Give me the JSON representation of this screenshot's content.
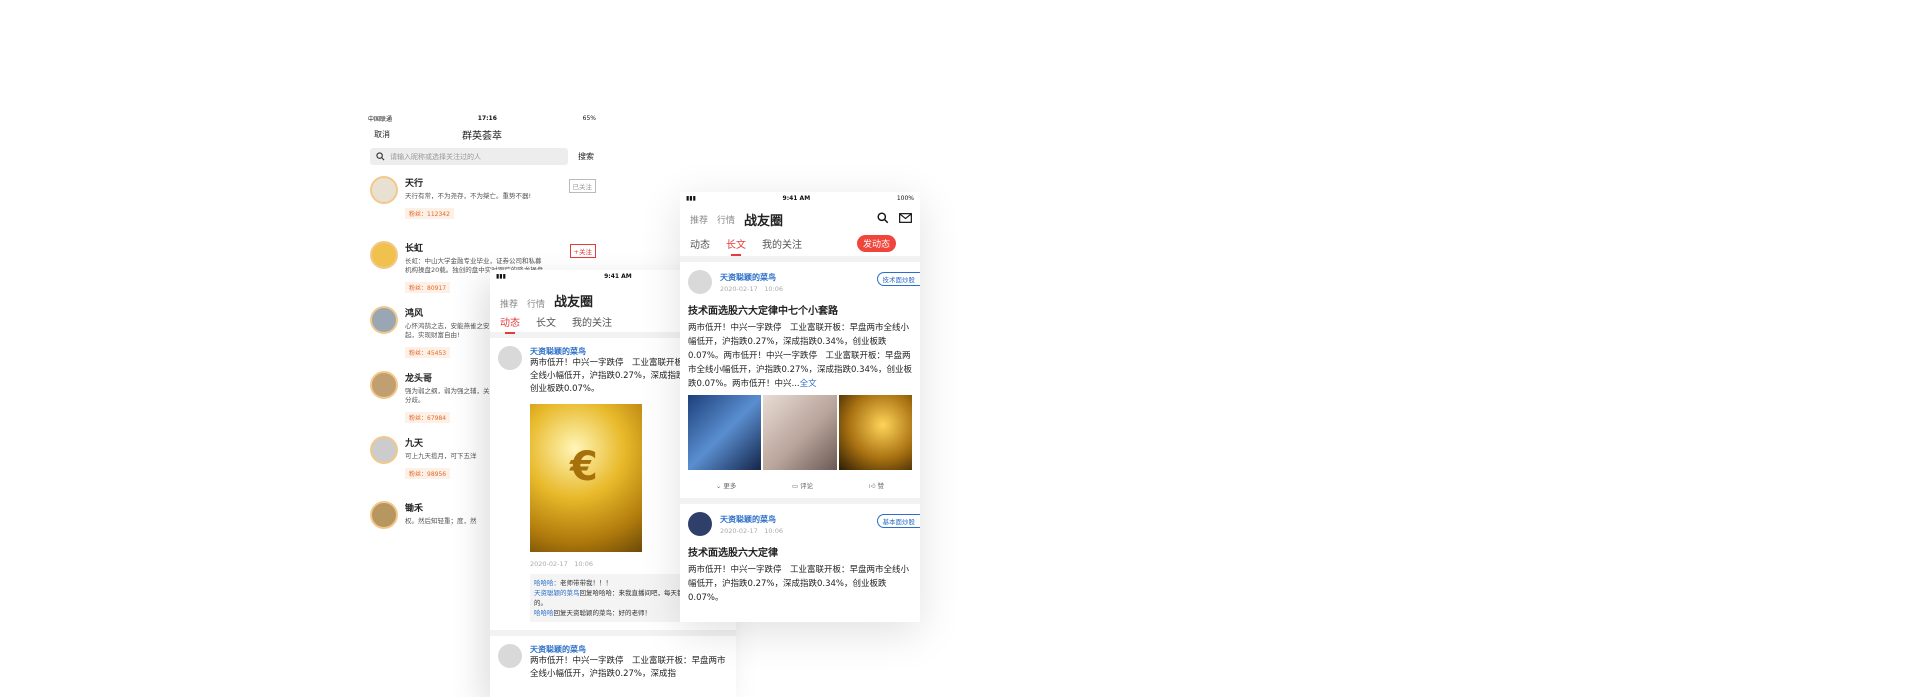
{
  "phone1": {
    "status": {
      "carrier": "中国联通",
      "time": "17:16",
      "battery": "65%"
    },
    "nav": {
      "cancel": "取消",
      "title": "群英荟萃"
    },
    "search": {
      "placeholder": "请输入昵称或选择关注过的人",
      "button": "搜索"
    },
    "users": [
      {
        "name": "天行",
        "desc": "天行有常，不为尧存，不为桀亡。重势不器!",
        "fans": "粉丝：112342",
        "follow": "已关注",
        "following": true
      },
      {
        "name": "长虹",
        "desc": "长虹：中山大学金融专业毕业，证券公司和私募机构操盘20载。独创的盘中实时跟踪的降龙操盘指标，股市不倒",
        "fans": "粉丝：80917",
        "follow": "+关注",
        "following": false
      },
      {
        "name": "鸿风",
        "desc": "心怀鸿鹄之志，安能燕雀之安，借东风扶摇而起，实现财富自由!",
        "fans": "粉丝：45453",
        "follow": "",
        "following": false
      },
      {
        "name": "龙头哥",
        "desc": "强为弱之纲，弱为强之辅，关注强势股，注下的分歧。",
        "fans": "粉丝：67984",
        "follow": "",
        "following": false
      },
      {
        "name": "九天",
        "desc": "可上九天揽月，可下五洋",
        "fans": "粉丝：98956",
        "follow": "",
        "following": false
      },
      {
        "name": "锄禾",
        "desc": "权。然后知轻重；度，然",
        "fans": "",
        "follow": "",
        "following": false
      }
    ]
  },
  "phone2": {
    "status": {
      "time": "9:41 AM"
    },
    "header": {
      "g1": "推荐",
      "g2": "行情",
      "title": "战友圈"
    },
    "tabs": [
      "动态",
      "长文",
      "我的关注"
    ],
    "post": {
      "user": "天资聪颖的菜鸟",
      "text": "两市低开！中兴一字跌停　工业富联开板：早盘两市全线小幅低开，沪指跌0.27%，深成指跌0.34%，创业板跌0.07%。",
      "time": "2020-02-17　10:06",
      "comments": [
        {
          "u": "哈哈哈：",
          "t": "老师带带我！！！"
        },
        {
          "u": "天资聪颖的菜鸟",
          "t": "回复哈哈哈：来我直播间吧，每天都会分享知识的。"
        },
        {
          "u": "哈哈哈",
          "t": "回复天资聪颖的菜鸟：好的老师！"
        }
      ]
    },
    "post2": {
      "user": "天资聪颖的菜鸟",
      "text": "两市低开！中兴一字跌停　工业富联开板：早盘两市全线小幅低开，沪指跌0.27%，深成指"
    }
  },
  "phone3": {
    "status": {
      "time": "9:41 AM",
      "battery": "100%"
    },
    "header": {
      "g1": "推荐",
      "g2": "行情",
      "title": "战友圈"
    },
    "tabs": [
      "动态",
      "长文",
      "我的关注"
    ],
    "publish": "发动态",
    "articles": [
      {
        "user": "天资聪颖的菜鸟",
        "time": "2020-02-17　10:06",
        "tag": "技术面炒股",
        "title": "技术面选股六大定律中七个小套路",
        "text": "两市低开！中兴一字跌停　工业富联开板：早盘两市全线小幅低开，沪指跌0.27%，深成指跌0.34%，创业板跌0.07%。两市低开！中兴一字跌停　工业富联开板：早盘两市全线小幅低开，沪指跌0.27%，深成指跌0.34%，创业板跌0.07%。两市低开！中兴...",
        "more": "全文",
        "actions": {
          "more": "更多",
          "comment": "评论",
          "like": "赞"
        }
      },
      {
        "user": "天资聪颖的菜鸟",
        "time": "2020-02-17　10:06",
        "tag": "基本面炒股",
        "title": "技术面选股六大定律",
        "text": "两市低开！中兴一字跌停　工业富联开板：早盘两市全线小幅低开，沪指跌0.27%，深成指跌0.34%，创业板跌0.07%。"
      }
    ]
  }
}
